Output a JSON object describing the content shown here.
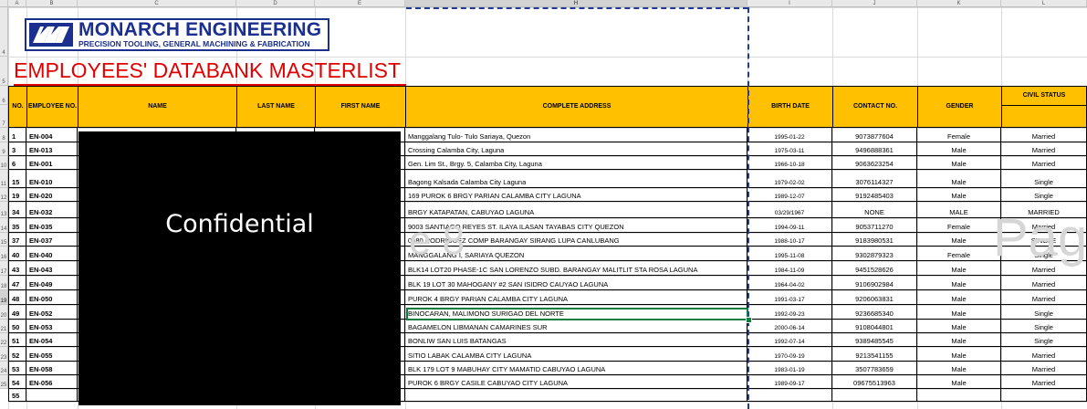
{
  "logo": {
    "name": "MONARCH ENGINEERING",
    "tagline": "PRECISION TOOLING, GENERAL MACHINING & FABRICATION",
    "color": "#1b2f8f"
  },
  "title": "EMPLOYEES' DATABANK MASTERLIST 2",
  "confidential_label": "Confidential",
  "watermarks": {
    "page_left": "e 8",
    "page_right": "Pag"
  },
  "columns": [
    "A",
    "B",
    "C",
    "D",
    "E",
    "H",
    "I",
    "J",
    "K",
    "L"
  ],
  "row_numbers": [
    "4",
    "5",
    "6",
    "7",
    "8",
    "9",
    "10",
    "11",
    "12",
    "13",
    "14",
    "15",
    "16",
    "17",
    "18",
    "19",
    "20",
    "21",
    "22",
    "23",
    "24",
    "25"
  ],
  "headers": {
    "no": "NO.",
    "employee_no": "EMPLOYEE NO.",
    "name": "NAME",
    "last_name": "LAST NAME",
    "first_name": "FIRST NAME",
    "address": "COMPLETE ADDRESS",
    "birth_date": "BIRTH DATE",
    "contact": "CONTACT NO.",
    "gender": "GENDER",
    "civil_status": "CIVIL STATUS"
  },
  "rows": [
    {
      "no": "1",
      "emp": "EN-004",
      "address": "Manggalang Tulo- Tulo Sariaya, Quezon",
      "birth": "1995-01-22",
      "contact": "9073877604",
      "gender": "Female",
      "civil": "Married"
    },
    {
      "no": "3",
      "emp": "EN-013",
      "address": "Crossing Calamba City, Laguna",
      "birth": "1975-03-11",
      "contact": "9496888361",
      "gender": "Male",
      "civil": "Married"
    },
    {
      "no": "6",
      "emp": "EN-001",
      "address": "Gen. Lim St., Brgy. 5, Calamba City, Laguna",
      "birth": "1966-10-18",
      "contact": "9063623254",
      "gender": "Male",
      "civil": "Married"
    },
    {
      "no": "15",
      "emp": "EN-010",
      "address": "Bagong Kalsada Calamba City Laguna",
      "birth": "1979-02-02",
      "contact": "3076114327",
      "gender": "Male",
      "civil": "Single"
    },
    {
      "no": "19",
      "emp": "EN-020",
      "address": "169 PUROK 6 BRGY PARIAN CALAMBA CITY LAGUNA",
      "birth": "1989-12-07",
      "contact": "9192485403",
      "gender": "Male",
      "civil": "Single"
    },
    {
      "no": "34",
      "emp": "EN-032",
      "address": "BRGY KATAPATAN, CABUYAO LAGUNA",
      "birth": "03/29/1967",
      "contact": "NONE",
      "gender": "MALE",
      "civil": "MARRIED"
    },
    {
      "no": "35",
      "emp": "EN-035",
      "address": "9003 SANTIAGO REYES ST. ILAYA ILASAN TAYABAS CITY QUEZON",
      "birth": "1994-09-11",
      "contact": "9053711270",
      "gender": "Female",
      "civil": "Married"
    },
    {
      "no": "37",
      "emp": "EN-037",
      "address": "0480 RODRIGUEZ COMP BARANGAY SIRANG LUPA CANLUBANG",
      "birth": "1988-10-17",
      "contact": "9183980531",
      "gender": "Male",
      "civil": "SINGLE"
    },
    {
      "no": "40",
      "emp": "EN-040",
      "address": "MANGGALANG I, SARIAYA QUEZON",
      "birth": "1995-11-08",
      "contact": "9302879323",
      "gender": "Female",
      "civil": "Single"
    },
    {
      "no": "43",
      "emp": "EN-043",
      "address": "BLK14 LOT20 PHASE-1C SAN LORENZO SUBD. BARANGAY MALITLIT STA ROSA LAGUNA",
      "birth": "1984-11-09",
      "contact": "9451528626",
      "gender": "Male",
      "civil": "Married"
    },
    {
      "no": "47",
      "emp": "EN-049",
      "address": "BLK 19 LOT 30 MAHOGANY #2 SAN ISIDRO CAUYAO LAGUNA",
      "birth": "1964-04-02",
      "contact": "9106902984",
      "gender": "Male",
      "civil": "Married"
    },
    {
      "no": "48",
      "emp": "EN-050",
      "address": "PUROK 4 BRGY PARIAN CALAMBA CITY LAGUNA",
      "birth": "1991-03-17",
      "contact": "9206063831",
      "gender": "Male",
      "civil": "Married"
    },
    {
      "no": "49",
      "emp": "EN-052",
      "address": "BINOCARAN, MALIMONO SURIGAO DEL NORTE",
      "birth": "1992-09-23",
      "contact": "9236685340",
      "gender": "Male",
      "civil": "Single"
    },
    {
      "no": "50",
      "emp": "EN-053",
      "address": "BAGAMELON LIBMANAN CAMARINES SUR",
      "birth": "2000-06-14",
      "contact": "9108044801",
      "gender": "Male",
      "civil": "Single"
    },
    {
      "no": "51",
      "emp": "EN-054",
      "address": "BONLIW SAN LUIS BATANGAS",
      "birth": "1992-07-14",
      "contact": "9389485545",
      "gender": "Male",
      "civil": "Single"
    },
    {
      "no": "52",
      "emp": "EN-055",
      "address": "SITIO LABAK CALAMBA CITY LAGUNA",
      "birth": "1970-09-19",
      "contact": "9213541155",
      "gender": "Male",
      "civil": "Married"
    },
    {
      "no": "53",
      "emp": "EN-058",
      "address": "BLK 179 LOT 9 MABUHAY CITY MAMATID CABUYAO LAGUNA",
      "birth": "1983-01-19",
      "contact": "3507783659",
      "gender": "Male",
      "civil": "Married"
    },
    {
      "no": "54",
      "emp": "EN-056",
      "address": "PUROK 6 BRGY CASILE CABUYAO CITY LAGUNA",
      "birth": "1989-09-17",
      "contact": "09675513963",
      "gender": "Male",
      "civil": "Married"
    },
    {
      "no": "55",
      "emp": "",
      "address": "",
      "birth": "",
      "contact": "",
      "gender": "",
      "civil": ""
    }
  ]
}
